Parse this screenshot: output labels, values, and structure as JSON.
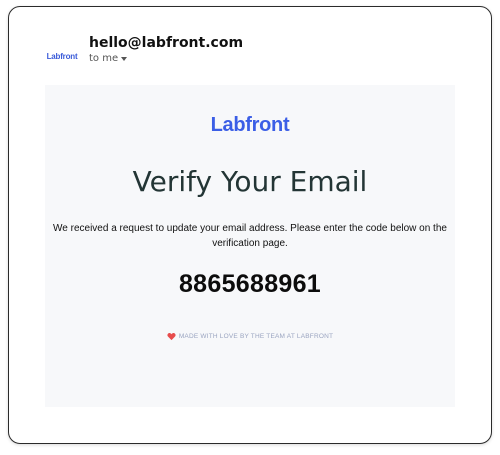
{
  "header": {
    "avatar_logo_text": "Labfront",
    "sender": "hello@labfront.com",
    "recipient": "to me",
    "recipient_icon": "chevron-down-icon"
  },
  "email": {
    "brand": "Labfront",
    "heading": "Verify Your Email",
    "message_line1": "We received a request to update your email address.  Please enter the code below on the",
    "message_line2": "verification page.",
    "code": "8865688961",
    "footer_icon": "heart-icon",
    "footer_text": "MADE WITH LOVE BY THE TEAM AT LABFRONT"
  },
  "colors": {
    "brand": "#3b5ee6",
    "heading": "#233535",
    "card_bg": "#f7f8fa",
    "heart": "#e74c4c",
    "footer_text": "#9aa4c0"
  }
}
